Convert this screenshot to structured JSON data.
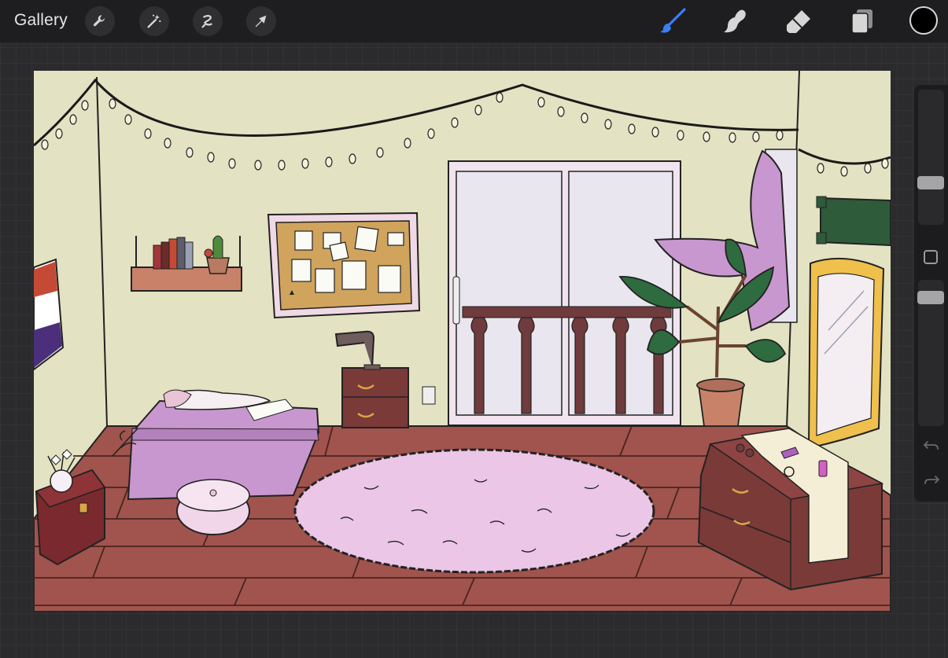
{
  "topbar": {
    "gallery_label": "Gallery",
    "left_tools": [
      "wrench-icon",
      "magic-wand-icon",
      "selection-icon",
      "transform-icon"
    ],
    "right_tools": [
      "brush-icon",
      "smudge-icon",
      "eraser-icon",
      "layers-icon"
    ],
    "active_tool": "brush",
    "active_color": "#000000",
    "accent": "#3b7ff5"
  },
  "canvas": {
    "description_colors": {
      "wall": "#e3e2c2",
      "floor": "#a0544d",
      "rug": "#ebc6e6",
      "bedspread": "#c997cf",
      "wood_dark": "#6f3b3c",
      "leaf": "#2e6b3f"
    }
  },
  "sidebar": {
    "brush_size": 0.5,
    "opacity": 0.92
  }
}
